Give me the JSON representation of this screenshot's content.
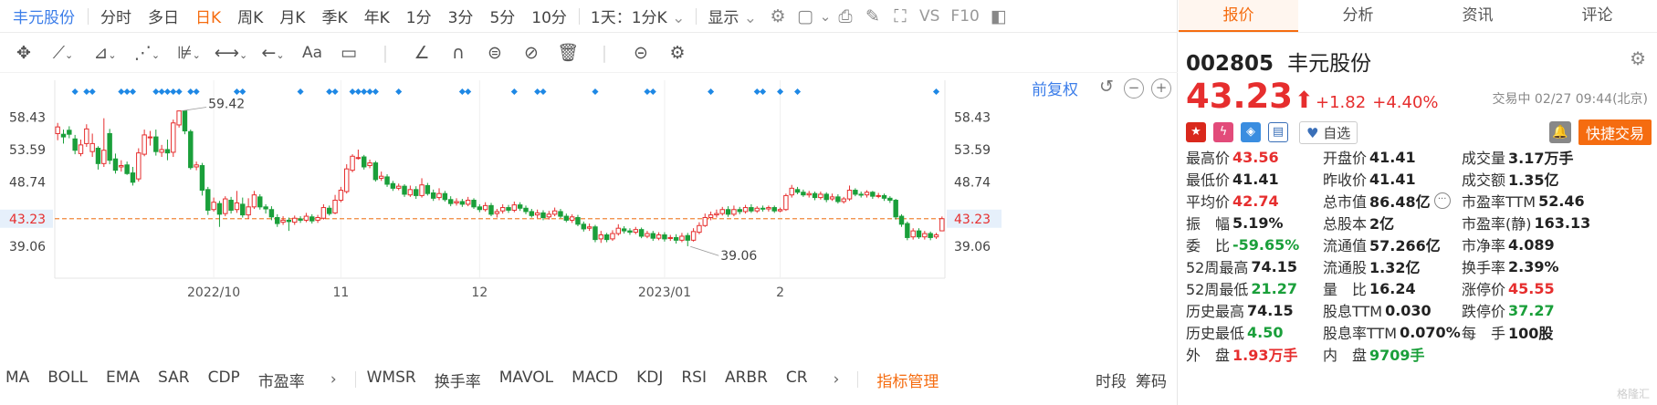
{
  "topbar": {
    "stock_name": "丰元股份",
    "periods": [
      "分时",
      "多日",
      "日K",
      "周K",
      "月K",
      "季K",
      "年K",
      "1分",
      "3分",
      "5分",
      "10分"
    ],
    "active_period": "日K",
    "interval_combo": "1天：1分K",
    "display_label": "显示",
    "vs_label": "VS",
    "f10_label": "F10"
  },
  "chart_controls": {
    "fq_label": "前复权"
  },
  "chart_data": {
    "type": "candlestick",
    "x_tick_labels": [
      "2022/10",
      "11",
      "12",
      "2023/01",
      "2"
    ],
    "y_tick_labels": [
      "58.43",
      "53.59",
      "48.74",
      "43.23",
      "39.06"
    ],
    "y_ticks": [
      58.43,
      53.59,
      48.74,
      43.23,
      39.06
    ],
    "ylim": [
      34.3,
      64.0
    ],
    "current_price": 43.23,
    "current_price_label": "43.23",
    "annotations": [
      {
        "label": "59.42",
        "value": 59.42,
        "index": 21
      },
      {
        "label": "39.06",
        "value": 39.06,
        "index": 109
      }
    ],
    "colors": {
      "up": "#e62e2e",
      "down": "#1a9f3a",
      "ref_line": "#f0883a",
      "marker": "#1e88e5"
    },
    "candles": [
      [
        56.0,
        57.0,
        55.0,
        57.6
      ],
      [
        55.9,
        55.5,
        54.5,
        56.6
      ],
      [
        56.5,
        55.9,
        55.3,
        57.1
      ],
      [
        55.2,
        53.5,
        52.9,
        55.8
      ],
      [
        53.0,
        54.3,
        52.6,
        55.1
      ],
      [
        54.5,
        56.7,
        54.0,
        57.4
      ],
      [
        53.3,
        54.5,
        52.5,
        56.0
      ],
      [
        53.8,
        51.5,
        50.6,
        54.1
      ],
      [
        51.5,
        53.5,
        51.0,
        58.3
      ],
      [
        56.0,
        52.0,
        51.4,
        56.7
      ],
      [
        52.2,
        50.5,
        50.0,
        53.0
      ],
      [
        51.0,
        51.2,
        50.3,
        52.0
      ],
      [
        51.3,
        50.0,
        49.8,
        51.8
      ],
      [
        50.1,
        48.7,
        48.2,
        51.0
      ],
      [
        49.2,
        53.1,
        48.8,
        53.8
      ],
      [
        52.9,
        55.8,
        52.6,
        56.6
      ],
      [
        55.5,
        55.5,
        54.2,
        56.4
      ],
      [
        55.5,
        53.3,
        52.7,
        56.6
      ],
      [
        53.2,
        53.6,
        52.5,
        54.3
      ],
      [
        53.6,
        53.1,
        52.0,
        55.1
      ],
      [
        53.2,
        57.6,
        52.5,
        58.1
      ],
      [
        57.3,
        59.4,
        56.9,
        59.4
      ],
      [
        59.4,
        56.4,
        55.9,
        59.4
      ],
      [
        56.3,
        50.9,
        50.6,
        56.6
      ],
      [
        51.0,
        51.3,
        50.5,
        51.8
      ],
      [
        51.2,
        47.5,
        46.7,
        51.6
      ],
      [
        47.6,
        44.5,
        43.8,
        48.0
      ],
      [
        44.6,
        45.7,
        44.3,
        46.4
      ],
      [
        45.5,
        43.9,
        42.0,
        45.9
      ],
      [
        44.0,
        46.2,
        43.6,
        46.6
      ],
      [
        46.0,
        44.5,
        44.0,
        46.5
      ],
      [
        44.6,
        45.6,
        44.1,
        47.4
      ],
      [
        45.4,
        43.8,
        43.4,
        46.4
      ],
      [
        43.8,
        45.0,
        43.2,
        46.3
      ],
      [
        45.0,
        46.8,
        44.7,
        47.4
      ],
      [
        46.5,
        45.0,
        44.6,
        46.9
      ],
      [
        45.0,
        44.7,
        44.0,
        45.4
      ],
      [
        44.6,
        43.5,
        43.0,
        45.1
      ],
      [
        43.4,
        42.5,
        42.0,
        43.9
      ],
      [
        42.7,
        43.0,
        42.3,
        43.6
      ],
      [
        43.0,
        42.8,
        41.4,
        43.4
      ],
      [
        42.7,
        43.3,
        42.3,
        43.7
      ],
      [
        43.2,
        43.0,
        42.6,
        43.6
      ],
      [
        43.0,
        43.6,
        42.7,
        44.1
      ],
      [
        43.5,
        42.9,
        42.5,
        43.9
      ],
      [
        43.0,
        43.4,
        42.6,
        43.8
      ],
      [
        43.3,
        44.9,
        43.1,
        45.4
      ],
      [
        44.8,
        44.0,
        43.7,
        45.2
      ],
      [
        44.1,
        46.0,
        43.9,
        46.8
      ],
      [
        46.0,
        47.5,
        45.7,
        48.0
      ],
      [
        47.3,
        50.7,
        47.0,
        51.4
      ],
      [
        50.5,
        52.6,
        50.2,
        52.9
      ],
      [
        52.4,
        52.4,
        52.1,
        53.6
      ],
      [
        52.5,
        51.0,
        50.6,
        52.8
      ],
      [
        51.2,
        51.6,
        50.8,
        52.1
      ],
      [
        51.6,
        49.1,
        48.8,
        51.9
      ],
      [
        49.3,
        49.6,
        48.9,
        50.3
      ],
      [
        49.5,
        48.4,
        48.0,
        49.9
      ],
      [
        48.5,
        47.8,
        47.4,
        48.9
      ],
      [
        47.8,
        48.1,
        47.5,
        48.5
      ],
      [
        48.1,
        46.9,
        46.5,
        48.4
      ],
      [
        46.8,
        47.6,
        46.5,
        48.2
      ],
      [
        47.6,
        46.7,
        46.2,
        48.1
      ],
      [
        46.7,
        48.3,
        46.4,
        49.3
      ],
      [
        48.2,
        47.0,
        46.7,
        48.6
      ],
      [
        47.1,
        46.3,
        45.9,
        47.6
      ],
      [
        46.4,
        47.0,
        46.0,
        47.8
      ],
      [
        47.0,
        46.1,
        45.8,
        47.4
      ],
      [
        46.1,
        45.5,
        45.1,
        46.6
      ],
      [
        45.6,
        45.8,
        45.2,
        46.3
      ],
      [
        45.8,
        45.4,
        45.0,
        46.2
      ],
      [
        45.4,
        46.0,
        45.1,
        46.5
      ],
      [
        46.0,
        45.0,
        44.7,
        46.3
      ],
      [
        45.0,
        44.6,
        44.2,
        45.4
      ],
      [
        44.6,
        45.2,
        44.3,
        45.7
      ],
      [
        45.2,
        43.9,
        43.6,
        45.6
      ],
      [
        44.0,
        44.3,
        43.4,
        44.7
      ],
      [
        44.4,
        44.9,
        44.0,
        45.4
      ],
      [
        44.9,
        44.5,
        44.1,
        45.3
      ],
      [
        44.5,
        45.3,
        44.2,
        45.8
      ],
      [
        45.3,
        44.8,
        44.4,
        45.7
      ],
      [
        44.8,
        44.3,
        43.9,
        45.2
      ],
      [
        44.3,
        43.7,
        43.4,
        44.7
      ],
      [
        43.8,
        44.1,
        43.3,
        44.6
      ],
      [
        44.1,
        43.4,
        43.0,
        44.5
      ],
      [
        43.5,
        43.9,
        43.1,
        44.4
      ],
      [
        43.9,
        44.4,
        43.6,
        44.9
      ],
      [
        44.3,
        43.6,
        43.3,
        44.7
      ],
      [
        43.6,
        43.0,
        42.7,
        44.0
      ],
      [
        43.0,
        43.5,
        42.6,
        43.9
      ],
      [
        43.4,
        42.4,
        42.1,
        43.8
      ],
      [
        42.4,
        41.7,
        41.3,
        42.8
      ],
      [
        41.8,
        42.0,
        41.4,
        42.5
      ],
      [
        42.0,
        40.1,
        39.7,
        42.3
      ],
      [
        40.2,
        40.8,
        39.6,
        41.4
      ],
      [
        40.8,
        40.1,
        39.7,
        41.1
      ],
      [
        40.2,
        41.0,
        39.9,
        41.5
      ],
      [
        41.0,
        41.8,
        40.7,
        42.4
      ],
      [
        41.7,
        41.4,
        41.0,
        42.1
      ],
      [
        41.4,
        41.2,
        40.8,
        41.8
      ],
      [
        41.2,
        41.6,
        40.9,
        42.0
      ],
      [
        41.6,
        40.6,
        40.3,
        41.9
      ],
      [
        40.6,
        41.0,
        40.3,
        41.4
      ],
      [
        41.0,
        40.3,
        39.9,
        41.4
      ],
      [
        40.3,
        40.8,
        40.0,
        41.2
      ],
      [
        40.8,
        40.2,
        39.8,
        41.2
      ],
      [
        40.3,
        40.4,
        39.9,
        40.8
      ],
      [
        40.4,
        40.0,
        39.5,
        40.9
      ],
      [
        40.0,
        40.6,
        39.7,
        41.1
      ],
      [
        40.7,
        40.0,
        39.1,
        41.1
      ],
      [
        40.0,
        41.3,
        39.8,
        41.8
      ],
      [
        41.2,
        42.2,
        40.9,
        42.7
      ],
      [
        42.2,
        43.4,
        42.0,
        44.0
      ],
      [
        43.4,
        43.8,
        43.0,
        44.3
      ],
      [
        43.8,
        44.0,
        43.4,
        44.6
      ],
      [
        44.0,
        44.6,
        43.7,
        45.0
      ],
      [
        44.6,
        43.9,
        43.5,
        45.1
      ],
      [
        43.9,
        44.6,
        43.6,
        45.2
      ],
      [
        44.6,
        44.3,
        43.9,
        45.0
      ],
      [
        44.3,
        44.9,
        44.0,
        45.3
      ],
      [
        44.9,
        44.4,
        44.1,
        45.4
      ],
      [
        44.4,
        44.8,
        44.1,
        45.1
      ],
      [
        44.8,
        44.7,
        44.3,
        45.2
      ],
      [
        44.7,
        44.9,
        44.3,
        45.2
      ],
      [
        44.9,
        44.4,
        44.1,
        45.2
      ],
      [
        44.4,
        44.6,
        44.2,
        44.9
      ],
      [
        44.6,
        46.7,
        44.4,
        47.0
      ],
      [
        46.8,
        47.8,
        46.4,
        48.3
      ],
      [
        47.6,
        47.2,
        46.9,
        48.0
      ],
      [
        47.2,
        46.8,
        46.5,
        47.6
      ],
      [
        46.8,
        47.0,
        46.4,
        47.4
      ],
      [
        47.0,
        46.4,
        46.0,
        47.3
      ],
      [
        46.4,
        46.9,
        46.1,
        47.3
      ],
      [
        46.9,
        46.1,
        45.7,
        47.2
      ],
      [
        46.2,
        46.5,
        45.9,
        47.0
      ],
      [
        46.5,
        45.8,
        45.5,
        46.9
      ],
      [
        45.8,
        46.2,
        45.5,
        46.5
      ],
      [
        46.2,
        47.5,
        45.9,
        48.2
      ],
      [
        47.5,
        46.9,
        46.6,
        47.8
      ],
      [
        46.9,
        46.8,
        46.4,
        47.3
      ],
      [
        46.8,
        47.2,
        46.4,
        47.5
      ],
      [
        47.2,
        46.6,
        46.2,
        47.4
      ],
      [
        46.6,
        46.7,
        46.3,
        47.1
      ],
      [
        46.7,
        46.3,
        45.9,
        47.0
      ],
      [
        46.3,
        46.0,
        45.6,
        46.6
      ],
      [
        46.0,
        43.5,
        43.1,
        46.2
      ],
      [
        43.6,
        42.4,
        42.0,
        43.9
      ],
      [
        42.5,
        40.4,
        40.0,
        42.8
      ],
      [
        40.5,
        41.4,
        40.1,
        41.8
      ],
      [
        41.4,
        40.5,
        40.2,
        41.8
      ],
      [
        40.5,
        41.0,
        40.1,
        41.4
      ],
      [
        41.0,
        40.4,
        40.0,
        41.3
      ],
      [
        40.5,
        40.8,
        40.2,
        41.1
      ],
      [
        41.41,
        43.23,
        41.41,
        43.56
      ]
    ],
    "marker_indices": [
      3,
      5,
      6,
      11,
      12,
      13,
      17,
      18,
      19,
      20,
      21,
      23,
      24,
      31,
      32,
      42,
      47,
      48,
      51,
      52,
      53,
      54,
      55,
      59,
      70,
      71,
      79,
      83,
      84,
      93,
      102,
      103,
      113,
      121,
      122,
      125,
      128,
      152
    ]
  },
  "indicators": {
    "items": [
      "MA",
      "BOLL",
      "EMA",
      "SAR",
      "CDP",
      "市盈率"
    ],
    "items2": [
      "WMSR",
      "换手率",
      "MAVOL",
      "MACD",
      "KDJ",
      "RSI",
      "ARBR",
      "CR"
    ],
    "manage_label": "指标管理",
    "right_items": [
      "时段",
      "筹码"
    ]
  },
  "tabs": [
    "报价",
    "分析",
    "资讯",
    "评论"
  ],
  "active_tab": "报价",
  "quote": {
    "code": "002805",
    "name": "丰元股份",
    "price": "43.23",
    "change": "+1.82",
    "change_pct": "+4.40%",
    "status": "交易中 02/27 09:44(北京)",
    "fav_label": "自选",
    "fast_trade_label": "快捷交易"
  },
  "stats": [
    [
      {
        "label": "最高价",
        "value": "43.56",
        "color": "red"
      },
      {
        "label": "开盘价",
        "value": "41.41",
        "color": "plain"
      },
      {
        "label": "成交量",
        "value": "3.17万手",
        "color": "plain"
      }
    ],
    [
      {
        "label": "最低价",
        "value": "41.41",
        "color": "plain"
      },
      {
        "label": "昨收价",
        "value": "41.41",
        "color": "plain"
      },
      {
        "label": "成交额",
        "value": "1.35亿",
        "color": "plain"
      }
    ],
    [
      {
        "label": "平均价",
        "value": "42.74",
        "color": "red"
      },
      {
        "label": "总市值",
        "value": "86.48亿",
        "color": "plain",
        "more": true
      },
      {
        "label": "市盈率TTM",
        "value": "52.46",
        "color": "plain"
      }
    ],
    [
      {
        "label": "振　幅",
        "value": "5.19%",
        "color": "plain"
      },
      {
        "label": "总股本",
        "value": "2亿",
        "color": "plain"
      },
      {
        "label": "市盈率(静)",
        "value": "163.13",
        "color": "plain"
      }
    ],
    [
      {
        "label": "委　比",
        "value": "-59.65%",
        "color": "green"
      },
      {
        "label": "流通值",
        "value": "57.266亿",
        "color": "plain"
      },
      {
        "label": "市净率",
        "value": "4.089",
        "color": "plain"
      }
    ],
    [
      {
        "label": "52周最高",
        "value": "74.15",
        "color": "plain"
      },
      {
        "label": "流通股",
        "value": "1.32亿",
        "color": "plain"
      },
      {
        "label": "换手率",
        "value": "2.39%",
        "color": "plain"
      }
    ],
    [
      {
        "label": "52周最低",
        "value": "21.27",
        "color": "green"
      },
      {
        "label": "量　比",
        "value": "16.24",
        "color": "plain"
      },
      {
        "label": "涨停价",
        "value": "45.55",
        "color": "red"
      }
    ],
    [
      {
        "label": "历史最高",
        "value": "74.15",
        "color": "plain"
      },
      {
        "label": "股息TTM",
        "value": "0.030",
        "color": "plain"
      },
      {
        "label": "跌停价",
        "value": "37.27",
        "color": "green"
      }
    ],
    [
      {
        "label": "历史最低",
        "value": "4.50",
        "color": "green"
      },
      {
        "label": "股息率TTM",
        "value": "0.070%",
        "color": "plain"
      },
      {
        "label": "每　手",
        "value": "100股",
        "color": "plain"
      }
    ],
    [
      {
        "label": "外　盘",
        "value": "1.93万手",
        "color": "red"
      },
      {
        "label": "内　盘",
        "value": "9709手",
        "color": "green"
      },
      null
    ]
  ],
  "watermark": "格隆汇"
}
